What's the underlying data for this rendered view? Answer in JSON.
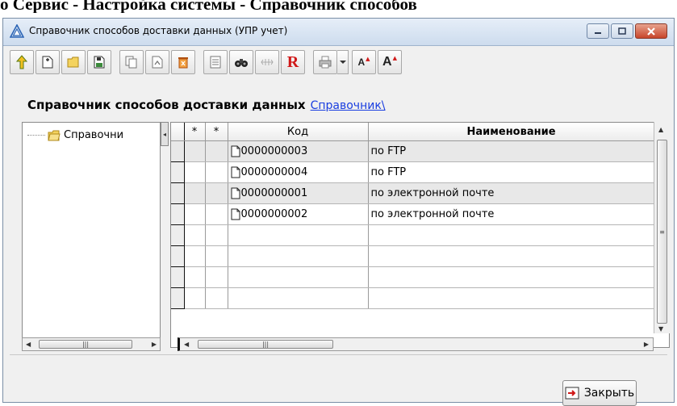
{
  "doc_heading": "о Сервис - Настройка системы - Справочник способов",
  "window": {
    "title": "Справочник способов доставки данных (УПР учет)"
  },
  "toolbar": {
    "icons": [
      "move-up-icon",
      "add-item-icon",
      "add-folder-icon",
      "save-icon",
      "copy-icon",
      "open-icon",
      "delete-icon",
      "list-icon",
      "binoculars-icon",
      "hierarchy-icon",
      "r-report-icon",
      "print-icon",
      "dropdown-icon",
      "font-decrease-icon",
      "font-increase-icon"
    ],
    "r_label": "R",
    "font_small": "A",
    "font_large": "A"
  },
  "header": {
    "title": "Справочник способов доставки данных",
    "breadcrumb_link": "Справочник\\"
  },
  "tree": {
    "root_label": "Справочни"
  },
  "grid": {
    "columns": [
      "*",
      "*",
      "Код",
      "Наименование"
    ],
    "rows": [
      {
        "code": "0000000003",
        "name": "по FTP"
      },
      {
        "code": "0000000004",
        "name": "по FTP"
      },
      {
        "code": "0000000001",
        "name": "по электронной почте"
      },
      {
        "code": "0000000002",
        "name": "по электронной почте"
      }
    ]
  },
  "footer": {
    "close_label": "Закрыть"
  },
  "colors": {
    "link": "#1a3ee0",
    "close_button": "#c7452a",
    "row_shade": "#e8e8e8"
  }
}
